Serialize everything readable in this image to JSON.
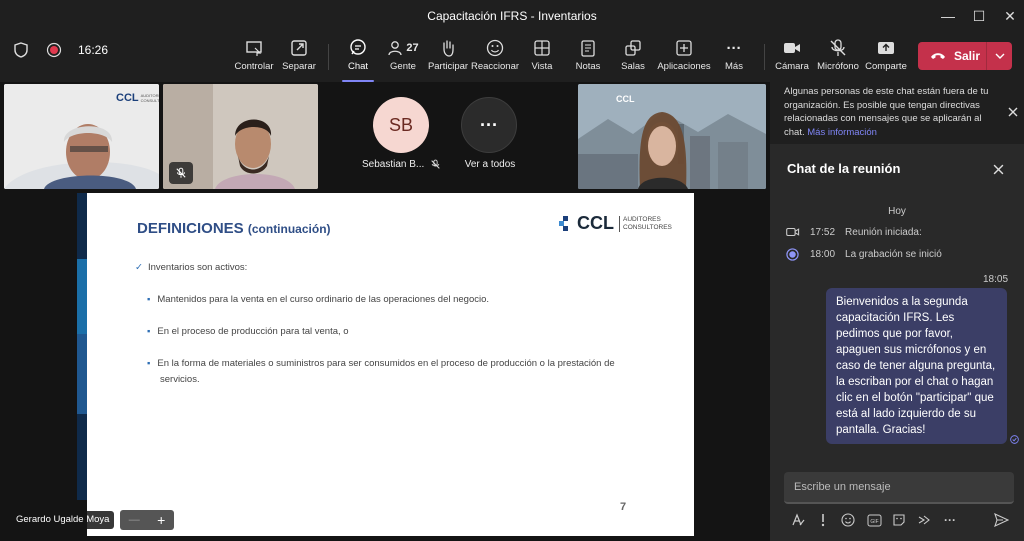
{
  "window": {
    "title": "Capacitación IFRS - Inventarios",
    "minimize": "—",
    "maximize": "☐",
    "close": "✕"
  },
  "call": {
    "timer": "16:26"
  },
  "toolbar": {
    "items": [
      {
        "label": "Controlar",
        "icon": "⬚"
      },
      {
        "label": "Separar",
        "icon": "⧉"
      },
      {
        "label": "Chat",
        "icon": "💬"
      },
      {
        "label": "Gente",
        "icon": "👤"
      },
      {
        "label": "Participar",
        "icon": "✋"
      },
      {
        "label": "Reaccionar",
        "icon": "☺"
      },
      {
        "label": "Vista",
        "icon": "⊞"
      },
      {
        "label": "Notas",
        "icon": "📋"
      },
      {
        "label": "Salas",
        "icon": "⧉"
      },
      {
        "label": "Aplicaciones",
        "icon": "⊕"
      },
      {
        "label": "Más",
        "icon": "···"
      },
      {
        "label": "Cámara",
        "icon": "📹"
      },
      {
        "label": "Micrófono",
        "icon": "🎙"
      },
      {
        "label": "Comparte",
        "icon": "⇪"
      }
    ],
    "people_count": "27",
    "leave_label": "Salir"
  },
  "participants": {
    "sb_initials": "SB",
    "sb_name": "Sebastian B...",
    "see_all_label": "Ver a todos",
    "see_all_icon": "···",
    "logo_text": "CCL",
    "logo_small": "AUDITORES\nCONSULTORES",
    "presenter_name": "Gerardo Ugalde Moya",
    "zoom_minus": "—",
    "zoom_plus": "+"
  },
  "slide": {
    "title": "DEFINICIONES",
    "title_suffix": "(continuación)",
    "logo_main": "CCL",
    "logo_line1": "AUDITORES",
    "logo_line2": "CONSULTORES",
    "check_item": "Inventarios son activos:",
    "bullets": [
      "Mantenidos para la venta en el curso ordinario de las operaciones del negocio.",
      "En el proceso de producción para tal venta, o",
      "En la forma de materiales o suministros para ser consumidos en el proceso de producción o la prestación de"
    ],
    "bullet3_cont": "servicios.",
    "page_number": "7"
  },
  "chat": {
    "notice": "Algunas personas de este chat están fuera de tu organización. Es posible que tengan directivas relacionadas con mensajes que se aplicarán al chat.",
    "notice_link": "Más información",
    "header": "Chat de la reunión",
    "day_label": "Hoy",
    "events": [
      {
        "time": "17:52",
        "text": "Reunión iniciada:"
      },
      {
        "time": "18:00",
        "text": "La grabación se inició"
      }
    ],
    "message_time": "18:05",
    "message": "Bienvenidos a la segunda capacitación IFRS. Les pedimos que por favor, apaguen sus micrófonos y en caso de tener alguna pregunta, la escriban por el chat o hagan clic en el botón \"participar\" que está al lado izquierdo de su pantalla. Gracias!",
    "composer_placeholder": "Escribe un mensaje"
  }
}
